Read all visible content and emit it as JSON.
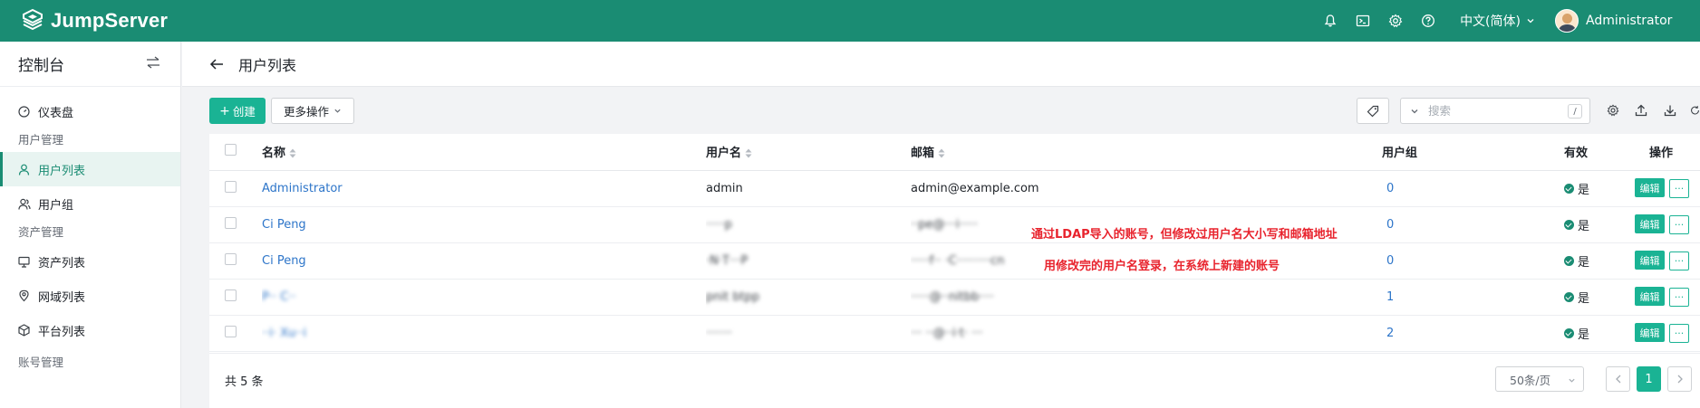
{
  "app": {
    "brand": "JumpServer"
  },
  "topbar": {
    "language": "中文(简体)",
    "user": "Administrator",
    "icons": [
      "bell-icon",
      "terminal-icon",
      "settings-icon",
      "help-icon"
    ]
  },
  "sidebar": {
    "title": "控制台",
    "switch_icon": "swap-icon",
    "dashboard": "仪表盘",
    "groups": [
      {
        "label": "用户管理",
        "items": [
          "用户列表",
          "用户组"
        ]
      },
      {
        "label": "资产管理",
        "items": [
          "资产列表",
          "网域列表",
          "平台列表"
        ]
      },
      {
        "label": "账号管理",
        "items": []
      }
    ],
    "active_item": "用户列表"
  },
  "page": {
    "title": "用户列表"
  },
  "toolbar": {
    "create_label": "创建",
    "more_label": "更多操作",
    "search_placeholder": "搜索",
    "search_shortcut": "/"
  },
  "table": {
    "columns": [
      "名称",
      "用户名",
      "邮箱",
      "用户组",
      "有效",
      "操作"
    ],
    "rows": [
      {
        "name": "Administrator",
        "username": "admin",
        "email": "admin@example.com",
        "groups": "0",
        "valid": "是"
      },
      {
        "name": "Ci Peng",
        "username": "·····p",
        "email": "··pe@···i·····",
        "groups": "0",
        "valid": "是"
      },
      {
        "name": "Ci Peng",
        "username": "·N·T···P",
        "email": "·····f·· ·C·········cn",
        "groups": "0",
        "valid": "是"
      },
      {
        "name": "P·· C··",
        "username": "pnit btpp",
        "email": "·····@··nitbb····",
        "groups": "1",
        "valid": "是"
      },
      {
        "name": "··i· Xu··i",
        "username": "·······",
        "email": "··· ··@··i·t· ···",
        "groups": "2",
        "valid": "是"
      }
    ],
    "edit_label": "编辑",
    "more_label": "···"
  },
  "annotations": [
    "通过LDAP导入的账号，但修改过用户名大小写和邮箱地址",
    "用修改完的用户名登录，在系统上新建的账号"
  ],
  "footer": {
    "total": "共 5 条",
    "page_size": "50条/页",
    "current_page": "1"
  },
  "colors": {
    "brand": "#1a8c73",
    "primary": "#1ab394",
    "link": "#2d75c9",
    "annotation": "#e8232d"
  }
}
